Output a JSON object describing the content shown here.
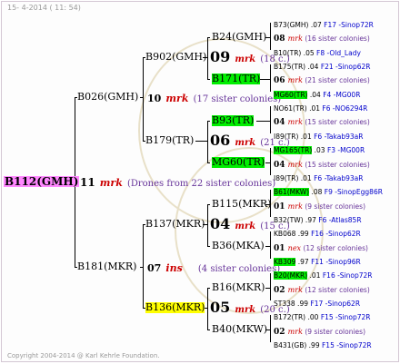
{
  "header": "15-  4-2014 ( 11: 54)",
  "copyright": "Copyright 2004-2014 @ Karl Kehrle Foundation.",
  "root": {
    "name": "B112(GMH)",
    "num": "11",
    "mark": "mrk",
    "note": "(Drones from 22 sister colonies)"
  },
  "p1": {
    "name": "B026(GMH)",
    "num": "10",
    "mark": "mrk",
    "note": "(17 sister colonies)"
  },
  "p2": {
    "name": "B181(MKR)",
    "num": "07",
    "mark": "ins",
    "note": "(4 sister colonies)"
  },
  "gp": [
    {
      "name": "B902(GMH)",
      "num": "09",
      "mark": "mrk",
      "note": "(18 c.)"
    },
    {
      "name": "B179(TR)",
      "num": "06",
      "mark": "mrk",
      "note": "(21 c.)"
    },
    {
      "name": "B137(MKR)",
      "num": "04",
      "mark": "mrk",
      "note": "(15 c.)"
    },
    {
      "name": "B136(MKR)",
      "num": "05",
      "mark": "mrk",
      "note": "(20 c.)"
    }
  ],
  "ggp": [
    {
      "name": "B24(GMH)"
    },
    {
      "name": "B171(TR)"
    },
    {
      "name": "B93(TR)"
    },
    {
      "name": "MG60(TR)"
    },
    {
      "name": "B115(MKR)"
    },
    {
      "name": "B36(MKA)"
    },
    {
      "name": "B16(MKR)"
    },
    {
      "name": "B40(MKW)"
    }
  ],
  "gen5": [
    {
      "kind": "queen",
      "name": "B73(GMH)",
      "extra": ".07",
      "code": "F17 -Sinop72R",
      "hl": ""
    },
    {
      "kind": "mating",
      "num": "08",
      "mark": "mrk",
      "note": "(16 sister colonies)"
    },
    {
      "kind": "queen",
      "name": "B10(TR)",
      "extra": ".05",
      "code": "F8 -Old_Lady",
      "hl": ""
    },
    {
      "kind": "queen",
      "name": "B175(TR)",
      "extra": ".04",
      "code": "F21 -Sinop62R",
      "hl": ""
    },
    {
      "kind": "mating",
      "num": "06",
      "mark": "mrk",
      "note": "(21 sister colonies)"
    },
    {
      "kind": "queen",
      "name": "MG60(TR)",
      "extra": ".04",
      "code": "F4 -MG00R",
      "hl": "green"
    },
    {
      "kind": "queen",
      "name": "NO61(TR)",
      "extra": ".01",
      "code": "F6 -NO6294R",
      "hl": ""
    },
    {
      "kind": "mating",
      "num": "04",
      "mark": "mrk",
      "note": "(15 sister colonies)"
    },
    {
      "kind": "queen",
      "name": "I89(TR)",
      "extra": ".01",
      "code": "F6 -Takab93aR",
      "hl": ""
    },
    {
      "kind": "queen",
      "name": "MG165(TR)",
      "extra": ".03",
      "code": "F3 -MG00R",
      "hl": "green"
    },
    {
      "kind": "mating",
      "num": "04",
      "mark": "mrk",
      "note": "(15 sister colonies)"
    },
    {
      "kind": "queen",
      "name": "I89(TR)",
      "extra": ".01",
      "code": "F6 -Takab93aR",
      "hl": ""
    },
    {
      "kind": "queen",
      "name": "B61(MKW)",
      "extra": ".08",
      "code": "F9 -SinopEgg86R",
      "hl": "green"
    },
    {
      "kind": "mating",
      "num": "01",
      "mark": "mrk",
      "note": "(9 sister colonies)"
    },
    {
      "kind": "queen",
      "name": "B32(TW)",
      "extra": ".97",
      "code": "F6 -Atlas85R",
      "hl": ""
    },
    {
      "kind": "queen",
      "name": "KB068",
      "extra": ".99",
      "code": "F16 -Sinop62R",
      "hl": ""
    },
    {
      "kind": "mating",
      "num": "01",
      "mark": "nex",
      "note": "(12 sister colonies)"
    },
    {
      "kind": "queen",
      "name": "KB309",
      "extra": ".97",
      "code": "F11 -Sinop96R",
      "hl": "green"
    },
    {
      "kind": "queen",
      "name": "B20(MKR)",
      "extra": ".01",
      "code": "F16 -Sinop72R",
      "hl": "green"
    },
    {
      "kind": "mating",
      "num": "02",
      "mark": "mrk",
      "note": "(12 sister colonies)"
    },
    {
      "kind": "queen",
      "name": "ST338",
      "extra": ".99",
      "code": "F17 -Sinop62R",
      "hl": ""
    },
    {
      "kind": "queen",
      "name": "B172(TR)",
      "extra": ".00",
      "code": "F15 -Sinop72R",
      "hl": ""
    },
    {
      "kind": "mating",
      "num": "02",
      "mark": "mrk",
      "note": "(9 sister colonies)"
    },
    {
      "kind": "queen",
      "name": "B431(GB)",
      "extra": ".99",
      "code": "F15 -Sinop72R",
      "hl": ""
    }
  ]
}
